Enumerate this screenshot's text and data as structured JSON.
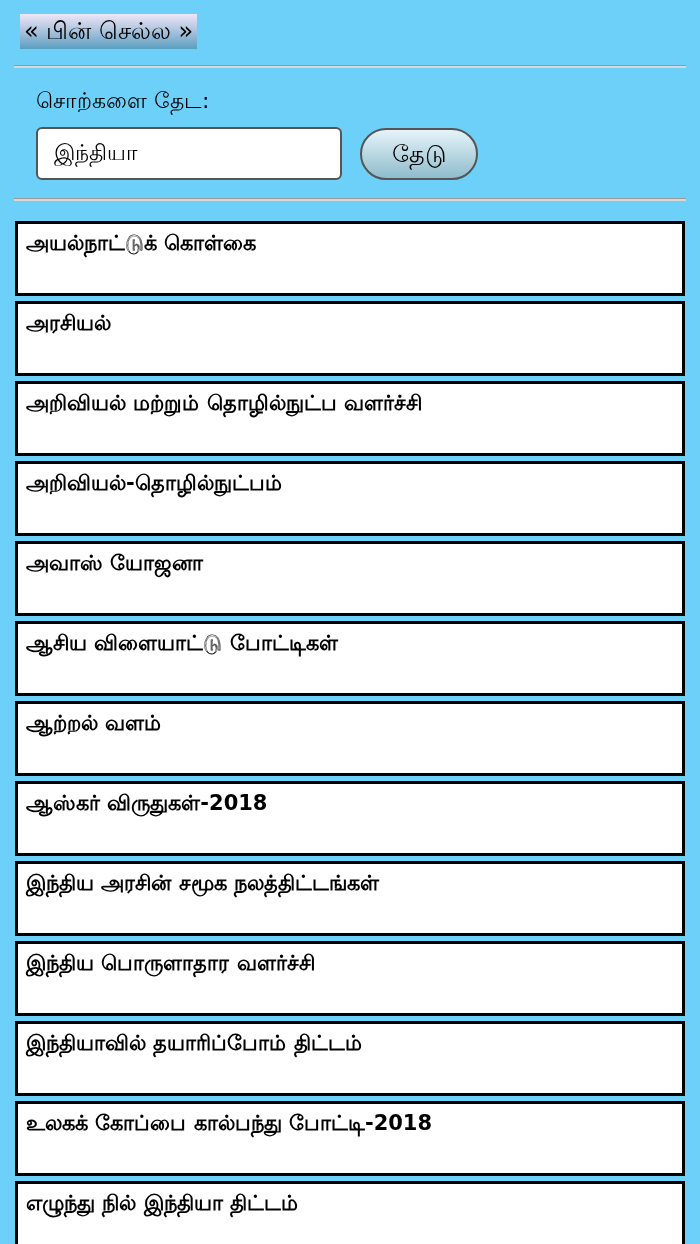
{
  "back_button": "« பின் செல்ல »",
  "search": {
    "label": "சொற்களை தேட:",
    "value": "இந்தியா",
    "button": "தேடு"
  },
  "results": [
    {
      "title": "அயல்நாட்டுக் கொள்கை"
    },
    {
      "title": "அரசியல்"
    },
    {
      "title": "அறிவியல் மற்றும் தொழில்நுட்ப வளர்ச்சி"
    },
    {
      "title": "அறிவியல்-தொழில்நுட்பம்"
    },
    {
      "title": "அவாஸ் யோஜனா"
    },
    {
      "title": "ஆசிய விளையாட்டு போட்டிகள்"
    },
    {
      "title": "ஆற்றல் வளம்"
    },
    {
      "title": "ஆஸ்கர் விருதுகள்-2018"
    },
    {
      "title": "இந்திய அரசின் சமூக நலத்திட்டங்கள்"
    },
    {
      "title": "இந்திய பொருளாதார வளர்ச்சி"
    },
    {
      "title": "இந்தியாவில் தயாரிப்போம் திட்டம்"
    },
    {
      "title": "உலகக் கோப்பை கால்பந்து போட்டி-2018"
    },
    {
      "title": "எழுந்து நில் இந்தியா திட்டம்"
    }
  ]
}
